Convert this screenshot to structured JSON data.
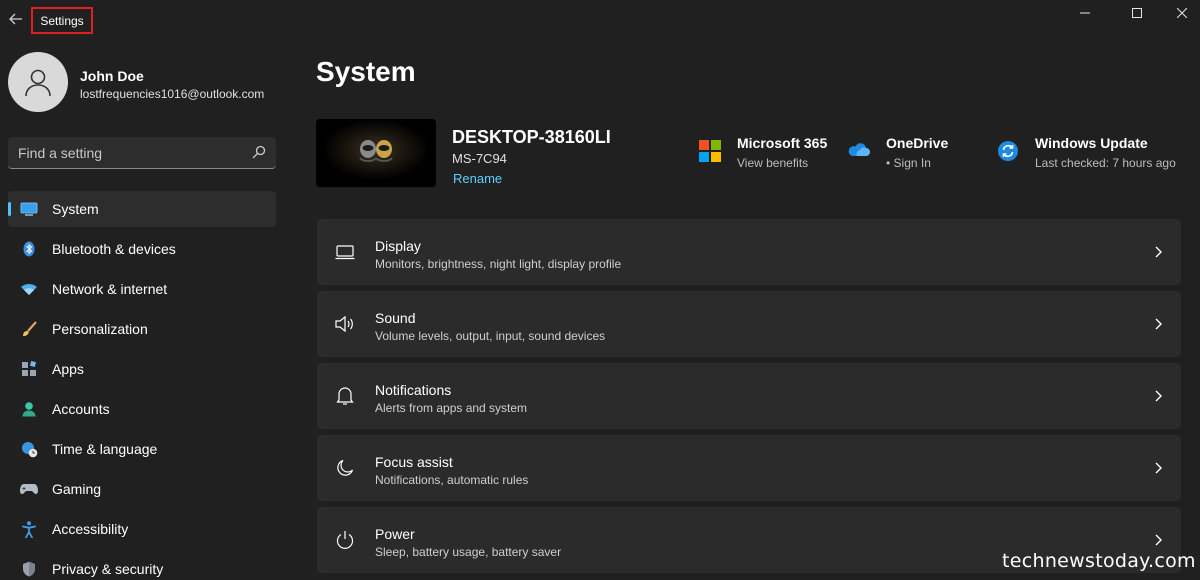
{
  "window": {
    "title": "Settings"
  },
  "user": {
    "name": "John Doe",
    "email": "lostfrequencies1016@outlook.com"
  },
  "search": {
    "placeholder": "Find a setting"
  },
  "sidebar": {
    "items": [
      {
        "label": "System",
        "icon": "monitor-icon",
        "active": true
      },
      {
        "label": "Bluetooth & devices",
        "icon": "bluetooth-icon"
      },
      {
        "label": "Network & internet",
        "icon": "wifi-icon"
      },
      {
        "label": "Personalization",
        "icon": "brush-icon"
      },
      {
        "label": "Apps",
        "icon": "apps-icon"
      },
      {
        "label": "Accounts",
        "icon": "person-icon"
      },
      {
        "label": "Time & language",
        "icon": "globe-clock-icon"
      },
      {
        "label": "Gaming",
        "icon": "gamepad-icon"
      },
      {
        "label": "Accessibility",
        "icon": "accessibility-icon"
      },
      {
        "label": "Privacy & security",
        "icon": "shield-icon"
      }
    ]
  },
  "main": {
    "title": "System",
    "device": {
      "name": "DESKTOP-38160LI",
      "model": "MS-7C94",
      "rename_label": "Rename"
    },
    "quick_links": [
      {
        "title": "Microsoft 365",
        "subtitle": "View benefits",
        "icon": "microsoft-logo-icon"
      },
      {
        "title": "OneDrive",
        "subtitle": "• Sign In",
        "icon": "cloud-icon"
      },
      {
        "title": "Windows Update",
        "subtitle": "Last checked: 7 hours ago",
        "icon": "refresh-icon"
      }
    ],
    "cards": [
      {
        "title": "Display",
        "subtitle": "Monitors, brightness, night light, display profile",
        "icon": "display-icon"
      },
      {
        "title": "Sound",
        "subtitle": "Volume levels, output, input, sound devices",
        "icon": "speaker-icon"
      },
      {
        "title": "Notifications",
        "subtitle": "Alerts from apps and system",
        "icon": "bell-icon"
      },
      {
        "title": "Focus assist",
        "subtitle": "Notifications, automatic rules",
        "icon": "moon-icon"
      },
      {
        "title": "Power",
        "subtitle": "Sleep, battery usage, battery saver",
        "icon": "power-icon"
      }
    ]
  },
  "watermark": "technewstoday.com",
  "colors": {
    "background": "#202020",
    "card": "#2b2b2b",
    "accent": "#4cc2ff",
    "link": "#60cdff",
    "highlight_box": "#e02020"
  }
}
